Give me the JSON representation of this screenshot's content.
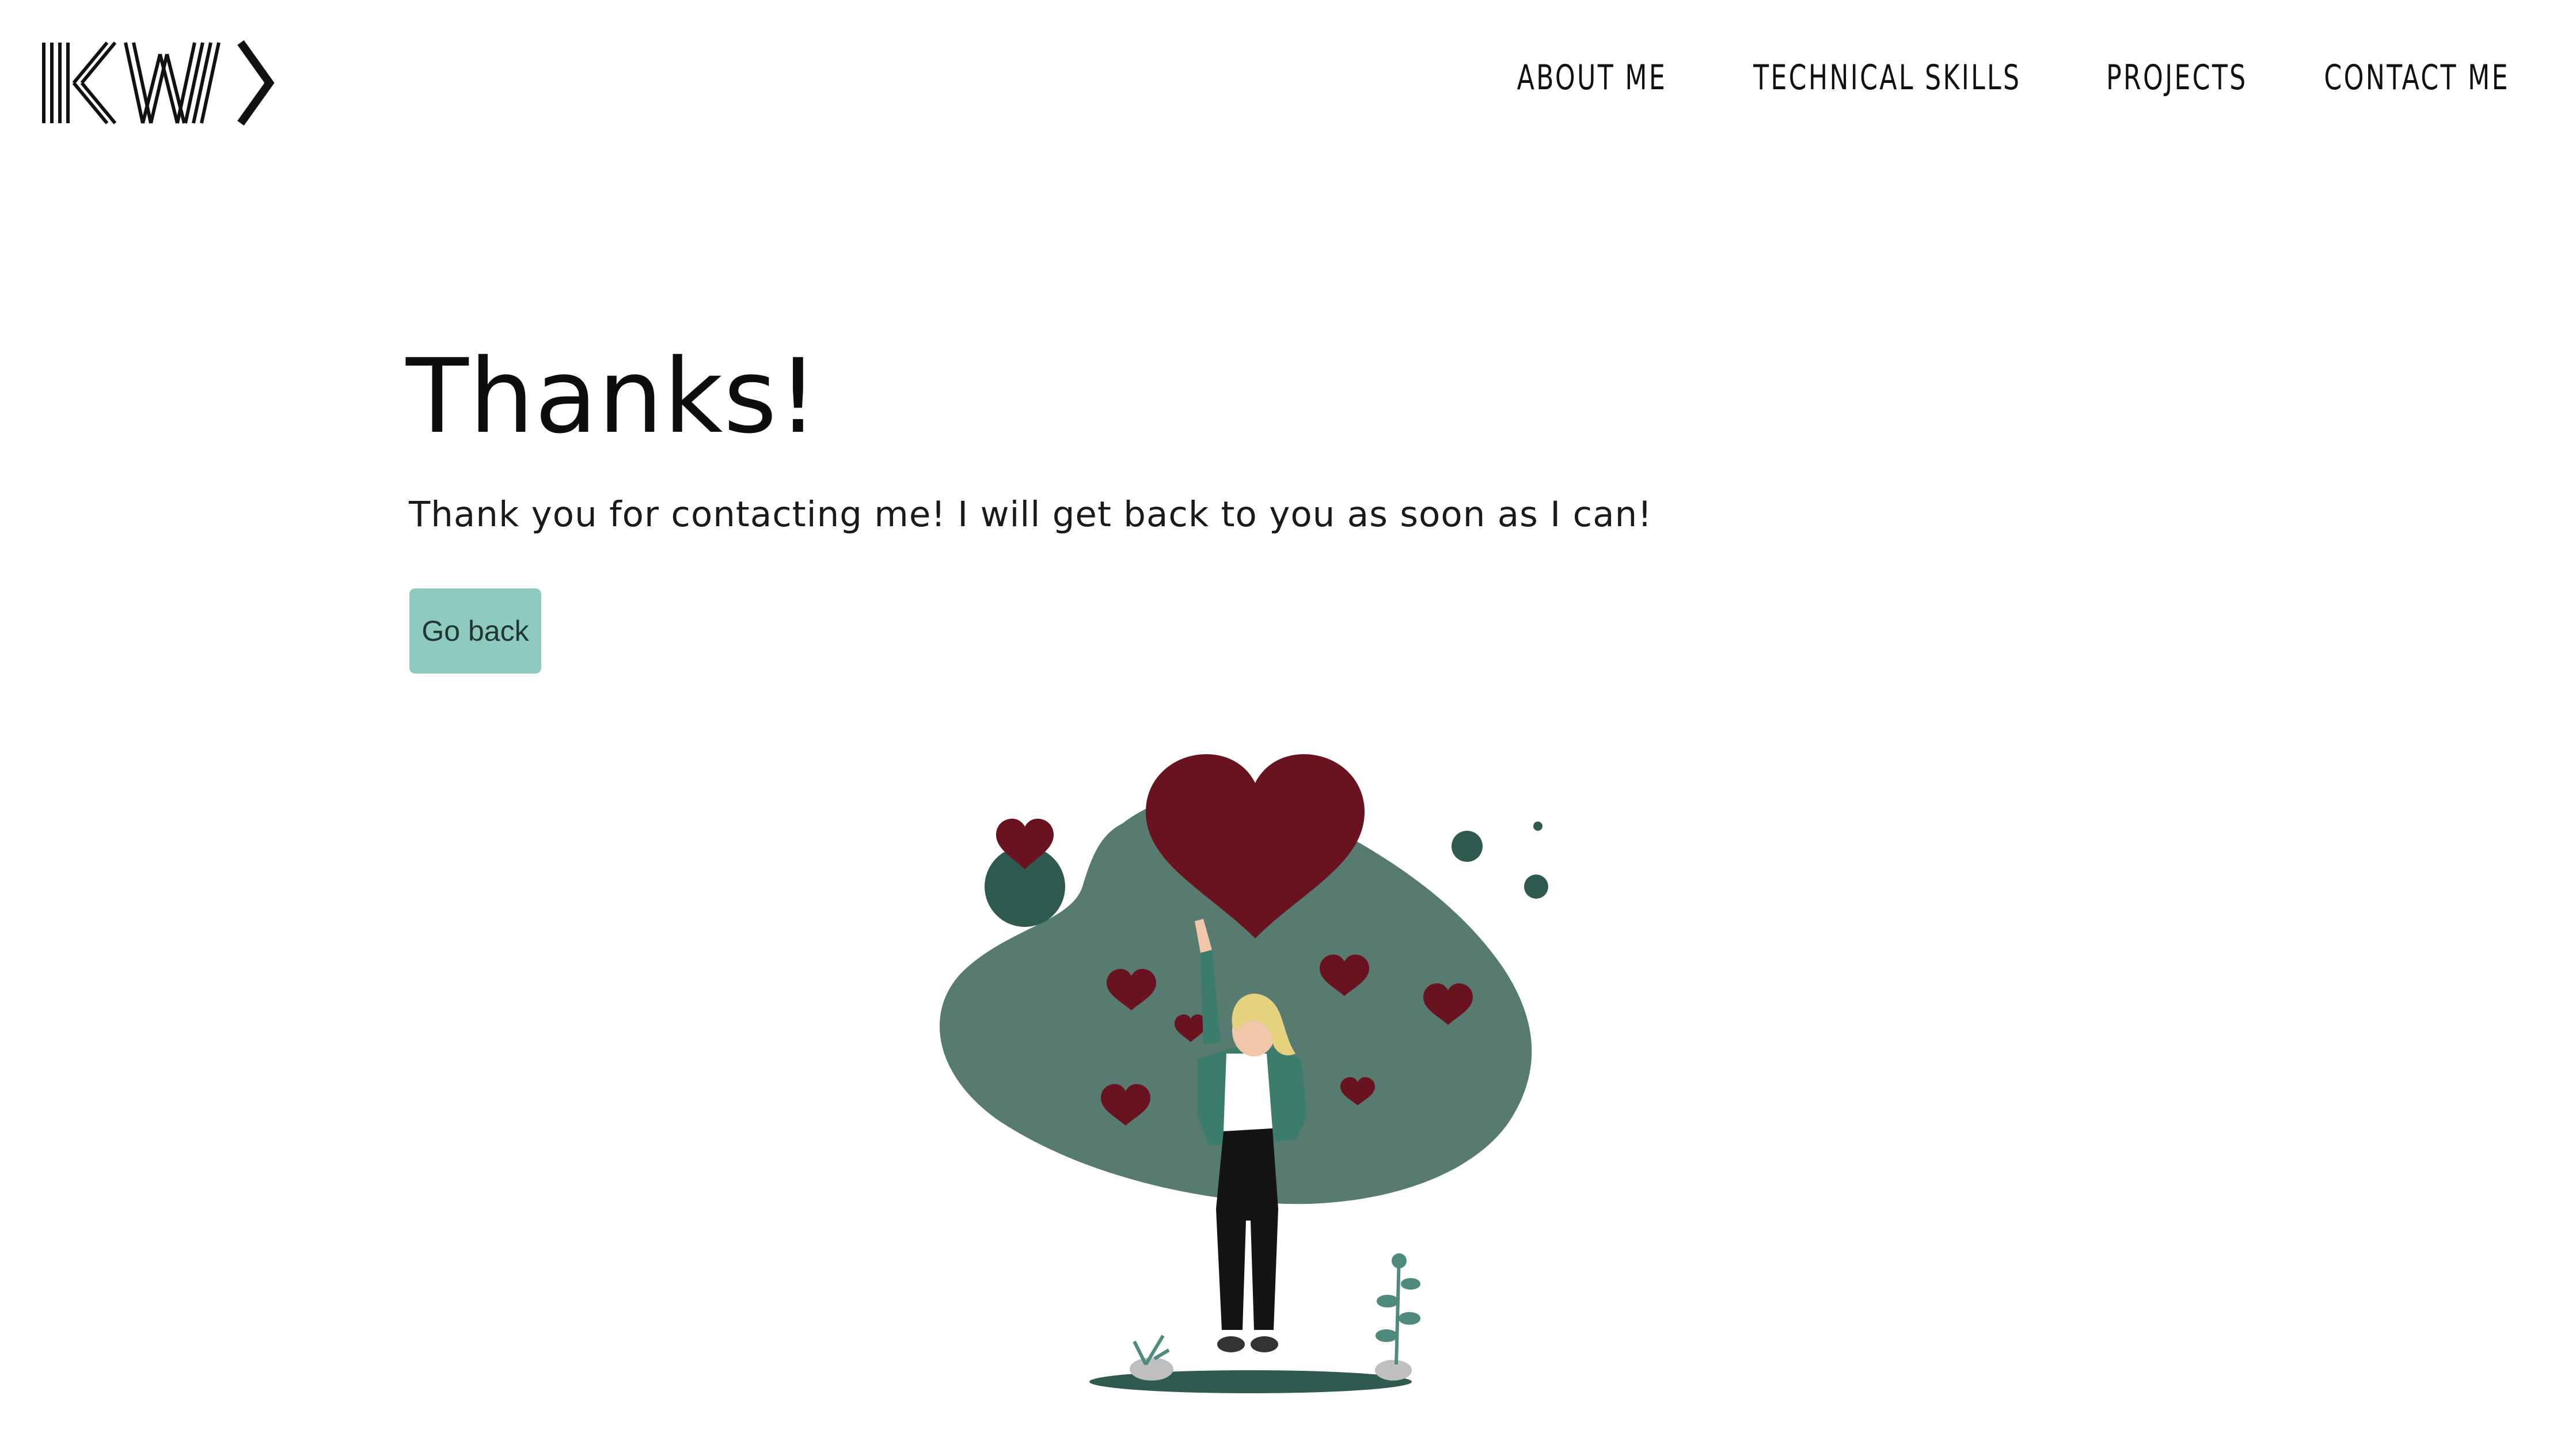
{
  "brand": {
    "logo_text": "KW",
    "logo_color": "#111111"
  },
  "nav": {
    "items": [
      {
        "label": "ABOUT ME"
      },
      {
        "label": "TECHNICAL SKILLS"
      },
      {
        "label": "PROJECTS"
      },
      {
        "label": "CONTACT ME"
      }
    ]
  },
  "main": {
    "title": "Thanks!",
    "message": "Thank you for contacting me! I will get back to you as soon as I can!",
    "button_label": "Go back"
  },
  "colors": {
    "button_bg": "#8fcac0",
    "blob_green": "#577b71",
    "dark_green": "#2e5a4f",
    "heart_red": "#6a1320",
    "hair_blonde": "#e6d27e"
  },
  "icons": {
    "logo": "kw-logo",
    "illustration": "woman-with-hearts-illustration"
  }
}
